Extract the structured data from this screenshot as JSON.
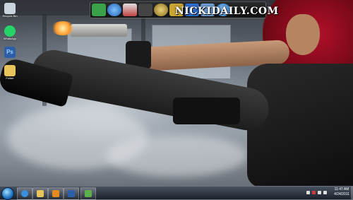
{
  "watermark": {
    "text": "NICKIDAILY.COM"
  },
  "desktop_icons": [
    {
      "label": "Recycle Bin",
      "icon": "recycle-bin-icon",
      "color": "#c9d4dc"
    },
    {
      "label": "WhatsApp",
      "icon": "whatsapp-icon",
      "color": "#25d366"
    },
    {
      "label": "Ps",
      "icon": "photoshop-icon",
      "color": "#2c5fa8"
    },
    {
      "label": "Folder",
      "icon": "folder-icon",
      "color": "#e7c55c"
    }
  ],
  "dock": {
    "icons": [
      {
        "name": "monitor-icon",
        "color": "#3ba04a"
      },
      {
        "name": "globe-icon",
        "color": "#3a7fd4"
      },
      {
        "name": "network-icon",
        "color": "#c04040"
      },
      {
        "name": "headphones-icon",
        "color": "#333333"
      },
      {
        "name": "film-reel-icon",
        "color": "#c9a531"
      },
      {
        "name": "lock-icon",
        "color": "#c9a531"
      },
      {
        "name": "help-icon",
        "color": "#2f6fd0"
      },
      {
        "name": "computer-icon",
        "color": "#6fa0d8"
      },
      {
        "name": "internet-explorer-icon",
        "color": "#3a8fe0"
      }
    ]
  },
  "taskbar": {
    "pinned": [
      {
        "name": "internet-explorer-icon",
        "color": "#3a8fe0"
      },
      {
        "name": "explorer-folder-icon",
        "color": "#e7c55c"
      },
      {
        "name": "media-player-icon",
        "color": "#e58a1f"
      },
      {
        "name": "photoshop-icon",
        "color": "#2c5fa8"
      },
      {
        "name": "app-icon",
        "color": "#5ab04a"
      }
    ],
    "tray_icons": [
      {
        "name": "flag-icon",
        "color": "#e0e0e0"
      },
      {
        "name": "antivirus-icon",
        "color": "#d03a3a"
      },
      {
        "name": "network-icon",
        "color": "#e0e0e0"
      },
      {
        "name": "volume-icon",
        "color": "#e0e0e0"
      }
    ],
    "clock": {
      "time": "11:47 AM",
      "date": "4/24/2011"
    }
  }
}
